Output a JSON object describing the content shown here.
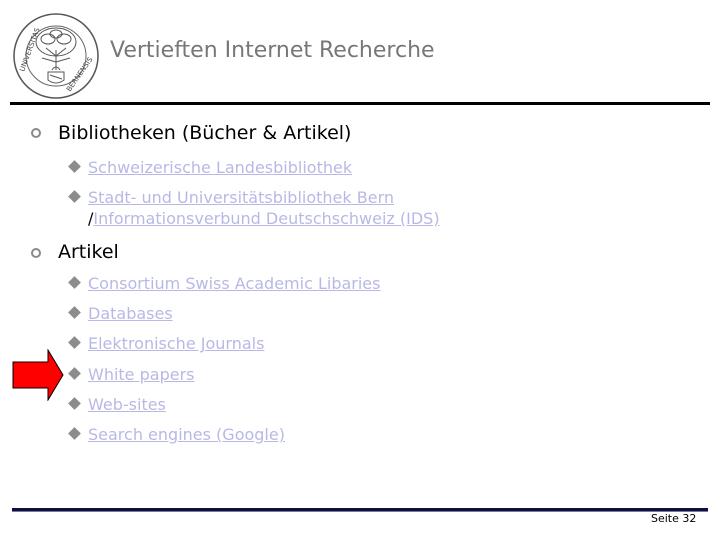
{
  "header": {
    "title": "Vertieften Internet Recherche",
    "logo": {
      "icon": "university-seal-icon",
      "text_left": "UNIVERSITAS",
      "text_right": "BERNENSIS"
    }
  },
  "content": {
    "sections": [
      {
        "heading": "Bibliotheken (Bücher & Artikel)",
        "items": [
          {
            "label": "Schweizerische Landesbibliothek"
          },
          {
            "label": "Stadt- und Universitätsbibliothek Bern",
            "separator": "/",
            "label_cont": "Informationsverbund Deutschschweiz (IDS)"
          }
        ]
      },
      {
        "heading": "Artikel",
        "items": [
          {
            "label": "Consortium Swiss Academic Libaries"
          },
          {
            "label": "Databases"
          },
          {
            "label": "Elektronische Journals"
          },
          {
            "label": "White papers"
          },
          {
            "label": "Web-sites"
          },
          {
            "label": "Search engines (Google)"
          }
        ]
      }
    ],
    "highlight": {
      "icon": "red-arrow-icon",
      "target": "White papers",
      "color": "#ff0000"
    }
  },
  "colors": {
    "title": "#777777",
    "link": "#b8b8e6",
    "bullet": "#8c8c8c",
    "rule": "#000000"
  },
  "footer": {
    "page_label": "Seite 32"
  }
}
